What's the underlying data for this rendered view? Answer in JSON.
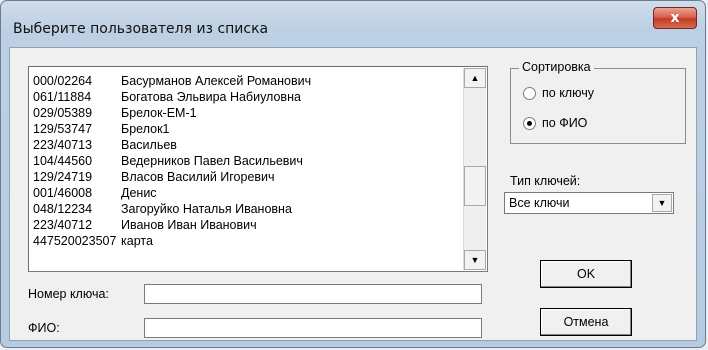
{
  "window": {
    "title": "Выберите пользователя из списка",
    "close_label": "x"
  },
  "users": [
    {
      "key": "000/02264",
      "name": "Басурманов Алексей Романович"
    },
    {
      "key": "061/11884",
      "name": "Богатова Эльвира Набиуловна"
    },
    {
      "key": "029/05389",
      "name": "Брелок-ЕМ-1"
    },
    {
      "key": "129/53747",
      "name": "Брелок1"
    },
    {
      "key": "223/40713",
      "name": "Васильев"
    },
    {
      "key": "104/44560",
      "name": "Ведерников Павел Васильевич"
    },
    {
      "key": "129/24719",
      "name": "Власов Василий Игоревич"
    },
    {
      "key": "001/46008",
      "name": "Денис"
    },
    {
      "key": "048/12234",
      "name": "Загоруйко Наталья Ивановна"
    },
    {
      "key": "223/40712",
      "name": "Иванов Иван Иванович"
    },
    {
      "key": "447520023507",
      "name": "карта"
    }
  ],
  "fields": {
    "key_label": "Номер ключа:",
    "key_value": "",
    "name_label": "ФИО:",
    "name_value": ""
  },
  "sorting": {
    "title": "Сортировка",
    "options": [
      "по ключу",
      "по ФИО"
    ],
    "selected_index": 1
  },
  "key_type": {
    "label": "Тип ключей:",
    "value": "Все ключи"
  },
  "buttons": {
    "ok": "OK",
    "cancel": "Отмена"
  },
  "icons": {
    "close": "close-icon",
    "scroll_up": "arrow-up-icon",
    "scroll_down": "arrow-down-icon",
    "dropdown": "chevron-down-icon"
  }
}
